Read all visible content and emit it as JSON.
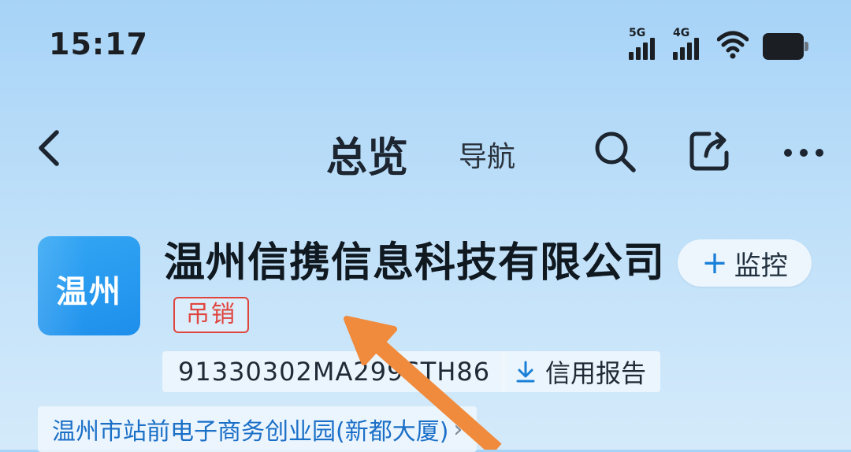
{
  "status_bar": {
    "time": "15:17",
    "network_5g": "5G",
    "network_4g": "4G",
    "icons": [
      "signal-5g-icon",
      "signal-4g-icon",
      "wifi-icon",
      "battery-icon"
    ]
  },
  "nav": {
    "title": "总览",
    "subtitle": "导航",
    "icons": [
      "back-icon",
      "search-icon",
      "share-icon",
      "more-icon"
    ]
  },
  "company": {
    "logo_text": "温州",
    "name": "温州信携信息科技有限公司",
    "status": "吊销",
    "monitor_label": "监控",
    "credit_code": "91330302MA299STH86",
    "report_label": "信用报告",
    "address": "温州市站前电子商务创业园(新都大厦)"
  },
  "colors": {
    "background_top": "#a7d3f7",
    "logo_blue": "#1d8fec",
    "status_red": "#e0453d",
    "link_blue": "#1a6fc7",
    "annotation_arrow": "#f08a3c"
  }
}
